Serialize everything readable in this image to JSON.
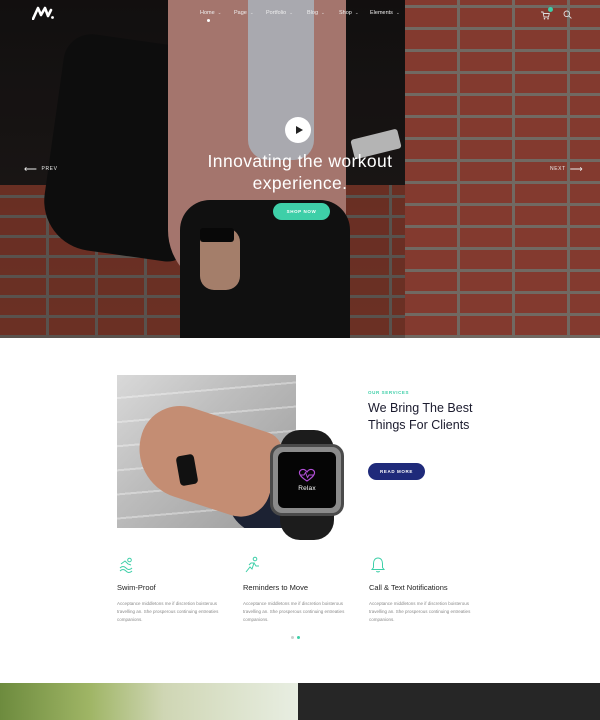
{
  "nav": {
    "items": [
      {
        "label": "Home"
      },
      {
        "label": "Page"
      },
      {
        "label": "Portfolio"
      },
      {
        "label": "Blog"
      },
      {
        "label": "Shop"
      },
      {
        "label": "Elements"
      }
    ],
    "caret": "⌄"
  },
  "hero": {
    "title_line1": "Innovating the workout",
    "title_line2": "experience.",
    "cta_label": "SHOP NOW",
    "prev_label": "PREV",
    "next_label": "NEXT",
    "prev_arrow": "⟵",
    "next_arrow": "⟶"
  },
  "services": {
    "eyebrow": "OUR SERVICES",
    "title": "We Bring The Best Things For Clients",
    "cta_label": "READ MORE",
    "device_screen_label": "Relax"
  },
  "features": [
    {
      "icon": "swim-icon",
      "title": "Swim-Proof",
      "text": "Acceptance middletons me if discretion boisterous travelling an. She prosperous continuing entreaties companions."
    },
    {
      "icon": "run-icon",
      "title": "Reminders to Move",
      "text": "Acceptance middletons me if discretion boisterous travelling an. She prosperous continuing entreaties companions."
    },
    {
      "icon": "bell-icon",
      "title": "Call & Text Notifications",
      "text": "Acceptance middletons me if discretion boisterous travelling an. She prosperous continuing entreaties companions."
    }
  ],
  "carousel": {
    "pages": 2,
    "active": 2
  },
  "colors": {
    "accent": "#3ecfa8",
    "primary_button": "#1f2a7a",
    "heading": "#1b1b2e",
    "body_text": "#8a8a8a"
  }
}
